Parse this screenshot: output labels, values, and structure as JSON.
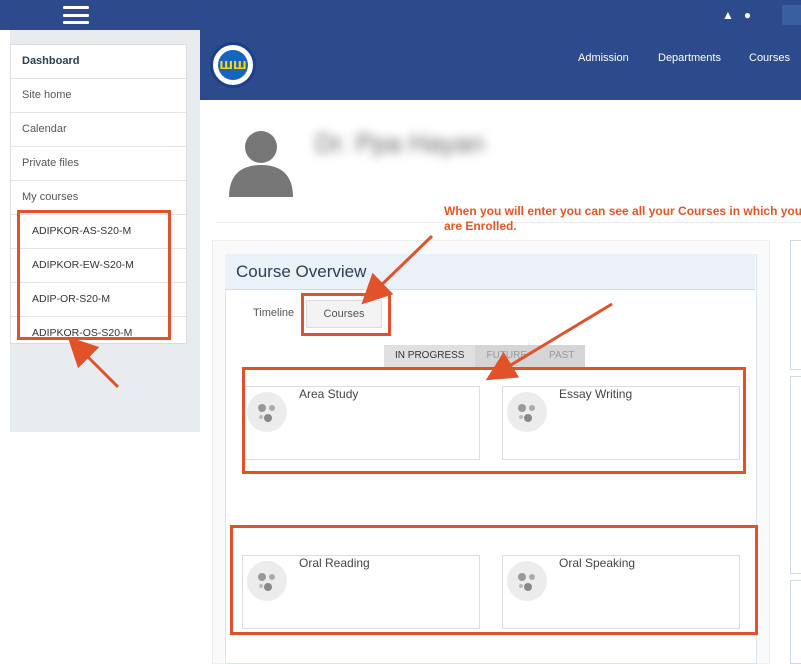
{
  "sidebar": {
    "items": [
      {
        "label": "Dashboard"
      },
      {
        "label": "Site home"
      },
      {
        "label": "Calendar"
      },
      {
        "label": "Private files"
      },
      {
        "label": "My courses"
      }
    ],
    "courses": [
      {
        "label": "ADIPKOR-AS-S20-M"
      },
      {
        "label": "ADIPKOR-EW-S20-M"
      },
      {
        "label": "ADIP-OR-S20-M"
      },
      {
        "label": "ADIPKOR-OS-S20-M"
      }
    ]
  },
  "header": {
    "logo_text": "ШШ",
    "nav": [
      {
        "label": "Admission"
      },
      {
        "label": "Departments"
      },
      {
        "label": "Courses"
      }
    ]
  },
  "profile": {
    "name": "Dr. Ppa Hayan"
  },
  "annotation": {
    "text": "When you will enter you can see all your Courses in which you are Enrolled."
  },
  "overview": {
    "title": "Course Overview",
    "tabs": [
      {
        "label": "Timeline"
      },
      {
        "label": "Courses"
      }
    ],
    "subtabs": [
      {
        "label": "IN PROGRESS"
      },
      {
        "label": "FUTURE"
      },
      {
        "label": "PAST"
      }
    ],
    "courses": [
      {
        "name": "Area Study",
        "icon": "course-icon"
      },
      {
        "name": "Essay Writing",
        "icon": "course-icon"
      },
      {
        "name": "Oral Reading",
        "icon": "course-icon"
      },
      {
        "name": "Oral Speaking",
        "icon": "course-icon"
      }
    ]
  },
  "colors": {
    "header_bg": "#2c4a8c",
    "annotation": "#e0522a"
  }
}
